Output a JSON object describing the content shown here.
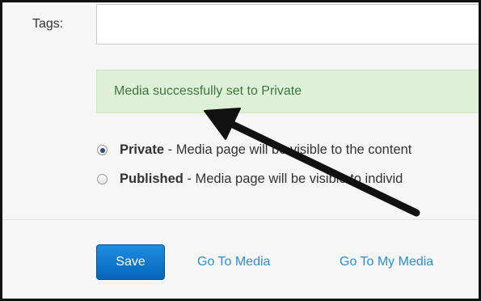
{
  "form": {
    "tags_label": "Tags:",
    "tags_value": ""
  },
  "alert": {
    "message": "Media successfully set to Private"
  },
  "visibility": {
    "options": [
      {
        "title": "Private",
        "description": " - Media page will be visible to the content",
        "checked": true
      },
      {
        "title": "Published",
        "description": " - Media page will be visible to individ",
        "checked": false
      }
    ]
  },
  "actions": {
    "save_label": "Save",
    "go_to_media": "Go To Media",
    "go_to_my_media": "Go To My Media"
  },
  "annotation": {
    "arrow_icon": "arrow-pointer-icon",
    "arrow_color": "#111111"
  },
  "colors": {
    "alert_bg": "#dff0d8",
    "alert_text": "#3c763d",
    "primary_button": "#0a72c8",
    "link": "#2a8fd6"
  }
}
